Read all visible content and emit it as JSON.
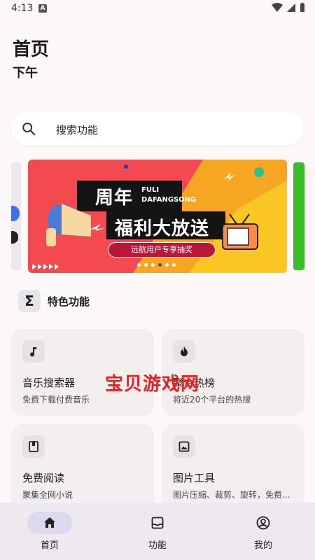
{
  "status": {
    "time": "4:13",
    "notification_letter": "A"
  },
  "header": {
    "title": "首页",
    "subtitle": "下午"
  },
  "search": {
    "placeholder": "搜索功能"
  },
  "banner": {
    "title_line1": "周年",
    "title_line2": "福利大放送",
    "en_line1": "FULI",
    "en_line2": "DAFANGSONG",
    "subtitle": "远航用户专享抽奖",
    "page_count": 6,
    "active_page": 3
  },
  "section": {
    "icon": "sigma-icon",
    "title": "特色功能"
  },
  "cards": [
    {
      "icon": "music-note-icon",
      "title": "音乐搜索器",
      "desc": "免费下载付费音乐"
    },
    {
      "icon": "fire-icon",
      "title": "聚合热榜",
      "desc": "将近20个平台的热搜"
    },
    {
      "icon": "book-icon",
      "title": "免费阅读",
      "desc": "聚集全网小说"
    },
    {
      "icon": "image-icon",
      "title": "图片工具",
      "desc": "图片压缩、裁剪、旋转，免费..."
    }
  ],
  "watermark": "宝贝游戏网",
  "nav": [
    {
      "icon": "home-icon",
      "label": "首页",
      "active": true
    },
    {
      "icon": "inbox-icon",
      "label": "功能",
      "active": false
    },
    {
      "icon": "account-icon",
      "label": "我的",
      "active": false
    }
  ]
}
